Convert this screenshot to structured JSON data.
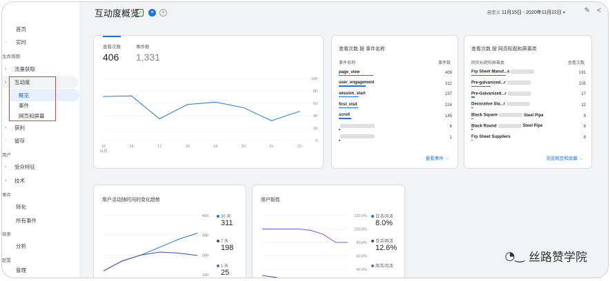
{
  "sidebar": {
    "home": "首页",
    "realtime": "实时",
    "lifecycle": "生命周期",
    "acquisition": "流量获取",
    "engagement": "互动度",
    "engagement_overview": "概览",
    "events": "事件",
    "pages_screens": "网页和屏幕",
    "monetization": "获利",
    "retention": "留存",
    "user": "用户",
    "demographics": "受众特征",
    "tech": "技术",
    "events_sec": "事件",
    "conversions": "转化",
    "all_events": "所有事件",
    "explore_sec": "探索",
    "analysis": "分析",
    "configure_sec": "配置",
    "admin": "管理"
  },
  "header": {
    "title": "互动度概览",
    "date_prefix": "自定义",
    "date_range": "11月15日 - 2020年11月22日"
  },
  "card1": {
    "tab1_label": "查看次数",
    "tab1_value": "406",
    "tab2_label": "事件数",
    "tab2_value": "1,331"
  },
  "card2": {
    "title": "查看次数 按 事件名称",
    "col1": "事件名称",
    "col2": "事件数",
    "rows": [
      {
        "name": "page_view",
        "value": "406",
        "frac": 1.0
      },
      {
        "name": "user_engagement",
        "value": "312",
        "frac": 0.77
      },
      {
        "name": "session_start",
        "value": "237",
        "frac": 0.58
      },
      {
        "name": "first_visit",
        "value": "224",
        "frac": 0.55
      },
      {
        "name": "scroll",
        "value": "145",
        "frac": 0.36
      },
      {
        "name": "",
        "value": "6",
        "frac": 0.02
      },
      {
        "name": "",
        "value": "1",
        "frac": 0.0
      }
    ],
    "link": "查看事件"
  },
  "card3": {
    "title": "查看次数 按 网页标题和屏幕类",
    "col1": "网页标题和屏幕类",
    "col2": "查看次数",
    "rows": [
      {
        "name": "Frp Sheet Manuf...s",
        "value": "191",
        "frac": 1.0
      },
      {
        "name": "Pre-galvanized...r",
        "value": "105",
        "frac": 0.55
      },
      {
        "name": "Pre-Galvanized...r",
        "value": "17",
        "frac": 0.09
      },
      {
        "name": "Decorative Sta...r",
        "value": "12",
        "frac": 0.06
      },
      {
        "name": "Black Square",
        "tail": "Steel Pipe",
        "value": "9",
        "frac": 0.05
      },
      {
        "name": "Black Round",
        "tail": "Steel Pipe",
        "value": "8",
        "frac": 0.04
      },
      {
        "name": "Frp Sheet Suppliers",
        "value": "8",
        "frac": 0.04
      }
    ],
    "link": "浏览网页和屏幕"
  },
  "card4": {
    "title": "用户活动随时间的变化趋势",
    "legend": [
      {
        "label": "30 天",
        "value": "311",
        "color": "#1a73e8"
      },
      {
        "label": "7 天",
        "value": "198",
        "color": "#3949ab"
      },
      {
        "label": "1 天",
        "value": "25",
        "color": "#7c4dff"
      }
    ]
  },
  "card5": {
    "title": "用户黏性",
    "legend": [
      {
        "label": "日活/月活",
        "value": "8.0%",
        "color": "#1a73e8"
      },
      {
        "label": "日活/周活",
        "value": "12.6%",
        "color": "#3949ab"
      },
      {
        "label": "周活/月活",
        "value": "",
        "color": "#7c4dff"
      }
    ]
  },
  "watermark": "丝路赞学院",
  "chart_data": [
    {
      "type": "line",
      "x": [
        "15 11月",
        "16",
        "17",
        "18",
        "19",
        "20",
        "21",
        "22"
      ],
      "xticks": [
        "15",
        "16",
        "17",
        "18",
        "19",
        "20",
        "21",
        "22"
      ],
      "xsub": "11月",
      "values": [
        71,
        72,
        35,
        58,
        62,
        53,
        32,
        47
      ],
      "ylim": [
        0,
        100
      ],
      "yticks": [
        "0",
        "20",
        "40",
        "60",
        "80",
        "100"
      ],
      "color": "#1a73e8"
    },
    {
      "type": "line",
      "series": [
        {
          "name": "30 天",
          "values": [
            120,
            170,
            200,
            240,
            280,
            311
          ],
          "color": "#1a73e8"
        },
        {
          "name": "7 天",
          "values": [
            120,
            170,
            200,
            215,
            210,
            198
          ],
          "color": "#3949ab"
        }
      ],
      "ylim": [
        100,
        400
      ],
      "yticks": [
        "400",
        "300",
        "200",
        "100"
      ]
    },
    {
      "type": "line",
      "series": [
        {
          "name": "日活/月活",
          "values": [
            100,
            100,
            100,
            100,
            98,
            92,
            80,
            80
          ],
          "color": "#7c4dff"
        },
        {
          "name": "日活/周活",
          "values": [
            0,
            0,
            0,
            0,
            0,
            0,
            0,
            0
          ],
          "color": "#3949ab"
        }
      ],
      "ylim": [
        40,
        120
      ],
      "yticks": [
        "120.0%",
        "100.0%",
        "80.0%",
        "60.0%",
        "40.0%"
      ]
    }
  ]
}
